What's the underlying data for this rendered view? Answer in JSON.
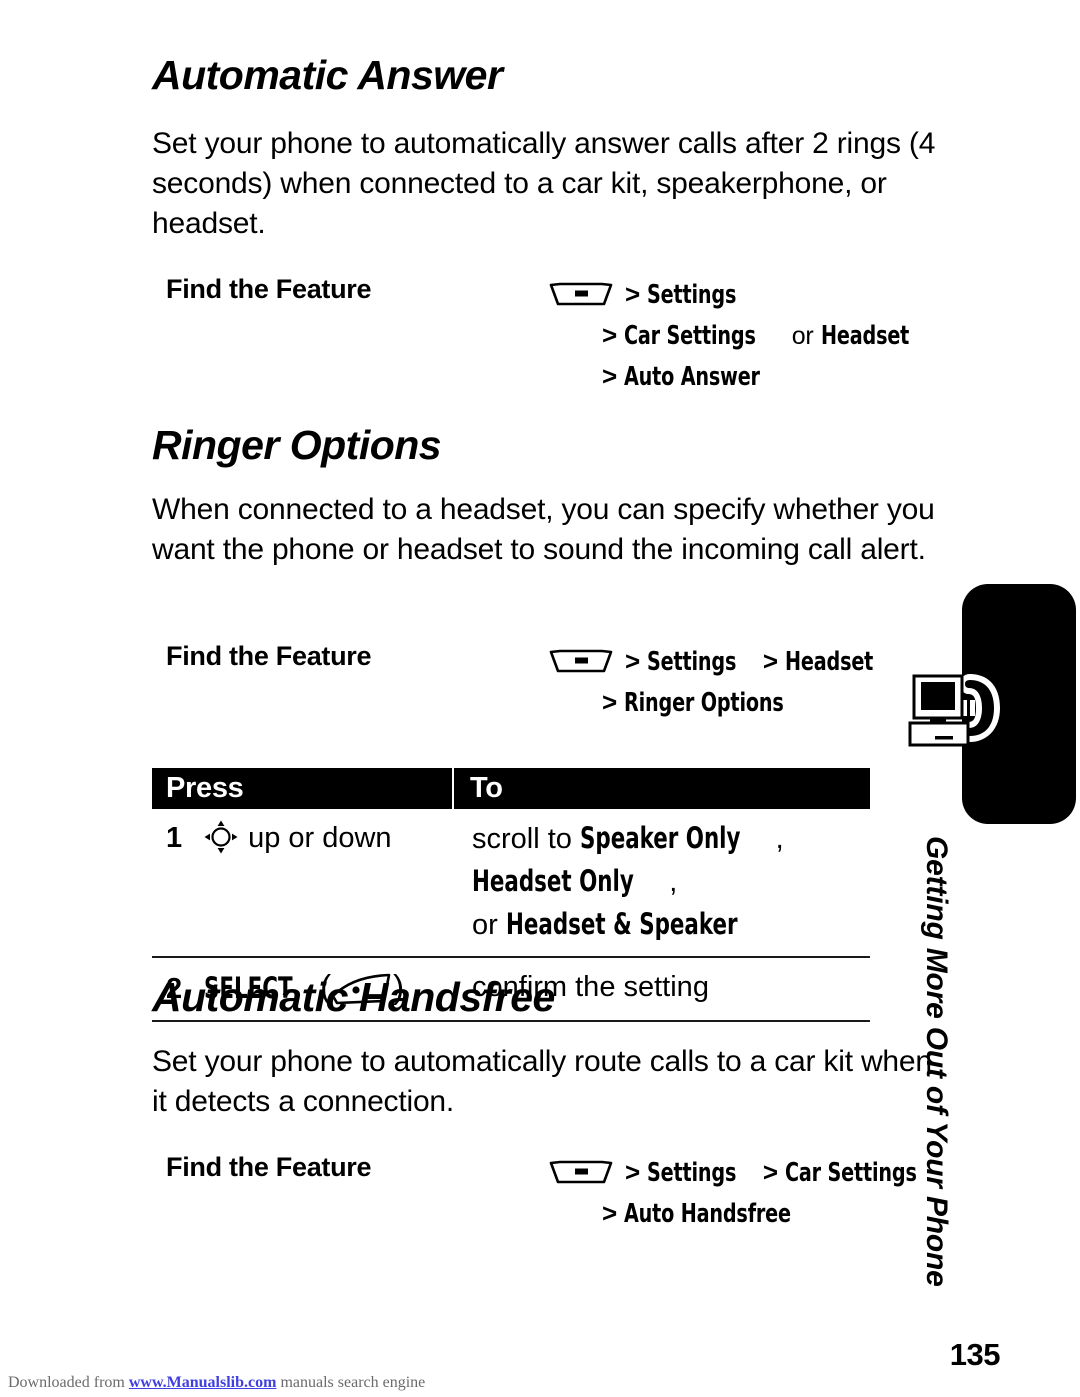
{
  "document": {
    "page_number": "135",
    "side_tab_label": "Getting More Out of Your Phone",
    "side_tab_icon": "computer-phone-icon"
  },
  "sections": [
    {
      "id": "automatic-answer",
      "heading": "Automatic Answer",
      "body": "Set your phone to automatically answer calls after 2 rings (4 seconds) when connected to a car kit, speakerphone, or headset.",
      "find_the_feature": {
        "label": "Find the Feature",
        "key_icon": "menu-key-icon",
        "lines": [
          {
            "sep": ">",
            "items": [
              {
                "text": "Settings",
                "style": "menu"
              }
            ]
          },
          {
            "sep": ">",
            "items": [
              {
                "text": "Car Settings",
                "style": "menu"
              },
              {
                "text": "or",
                "style": "plain"
              },
              {
                "text": "Headset",
                "style": "menu"
              }
            ]
          },
          {
            "sep": ">",
            "items": [
              {
                "text": "Auto Answer",
                "style": "menu"
              }
            ]
          }
        ]
      }
    },
    {
      "id": "ringer-options",
      "heading": "Ringer Options",
      "body": "When connected to a headset, you can specify whether you want the phone or headset to sound the incoming call alert.",
      "find_the_feature": {
        "label": "Find the Feature",
        "key_icon": "menu-key-icon",
        "lines": [
          {
            "sep": ">",
            "items": [
              {
                "text": "Settings",
                "style": "menu"
              },
              {
                "text": ">",
                "style": "sep"
              },
              {
                "text": "Headset",
                "style": "menu"
              }
            ]
          },
          {
            "sep": ">",
            "items": [
              {
                "text": "Ringer Options",
                "style": "menu"
              }
            ]
          }
        ]
      }
    },
    {
      "id": "automatic-handsfree",
      "heading": "Automatic Handsfree",
      "body": "Set your phone to automatically route calls to a car kit when it detects a connection.",
      "find_the_feature": {
        "label": "Find the Feature",
        "key_icon": "menu-key-icon",
        "lines": [
          {
            "sep": ">",
            "items": [
              {
                "text": "Settings",
                "style": "menu"
              },
              {
                "text": ">",
                "style": "sep"
              },
              {
                "text": "Car Settings",
                "style": "menu"
              }
            ]
          },
          {
            "sep": ">",
            "items": [
              {
                "text": "Auto Handsfree",
                "style": "menu"
              }
            ]
          }
        ]
      }
    }
  ],
  "procedure_table": {
    "headers": {
      "press": "Press",
      "to": "To"
    },
    "rows": [
      {
        "number": "1",
        "press_icon": "navigation-key-icon",
        "press_text": "up or down",
        "to_prefix": "scroll to ",
        "to_options": [
          "Speaker Only",
          "Headset Only",
          "Headset & Speaker"
        ],
        "to_line1": "scroll to Speaker Only, Headset Only,",
        "to_line2_lead": "or ",
        "to_line2_option": "Headset & Speaker"
      },
      {
        "number": "2",
        "press_label": "SELECT",
        "press_icon": "select-key-icon",
        "to_text": "confirm the setting"
      }
    ]
  },
  "footer": {
    "prefix": "Downloaded from ",
    "link": "www.Manualslib.com",
    "suffix": " manuals search engine"
  }
}
